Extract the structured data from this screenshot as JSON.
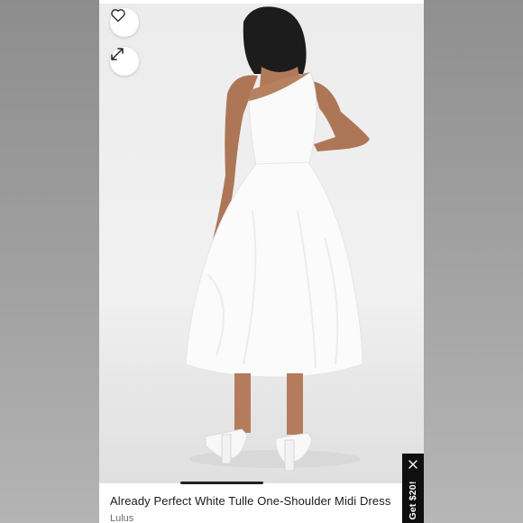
{
  "product": {
    "title": "Already Perfect White Tulle One-Shoulder Midi Dress",
    "brand": "Lulus"
  },
  "actions": {
    "favorite_icon": "heart-icon",
    "expand_icon": "expand-arrows-icon"
  },
  "promo": {
    "label": "Get $20!",
    "close_icon": "close-icon"
  },
  "colors": {
    "page_bg": "#9a9a9a",
    "card_bg": "#ffffff",
    "promo_bg": "#0f0f0f",
    "title_text": "#1a1a1a",
    "brand_text": "#6b6b6b"
  }
}
